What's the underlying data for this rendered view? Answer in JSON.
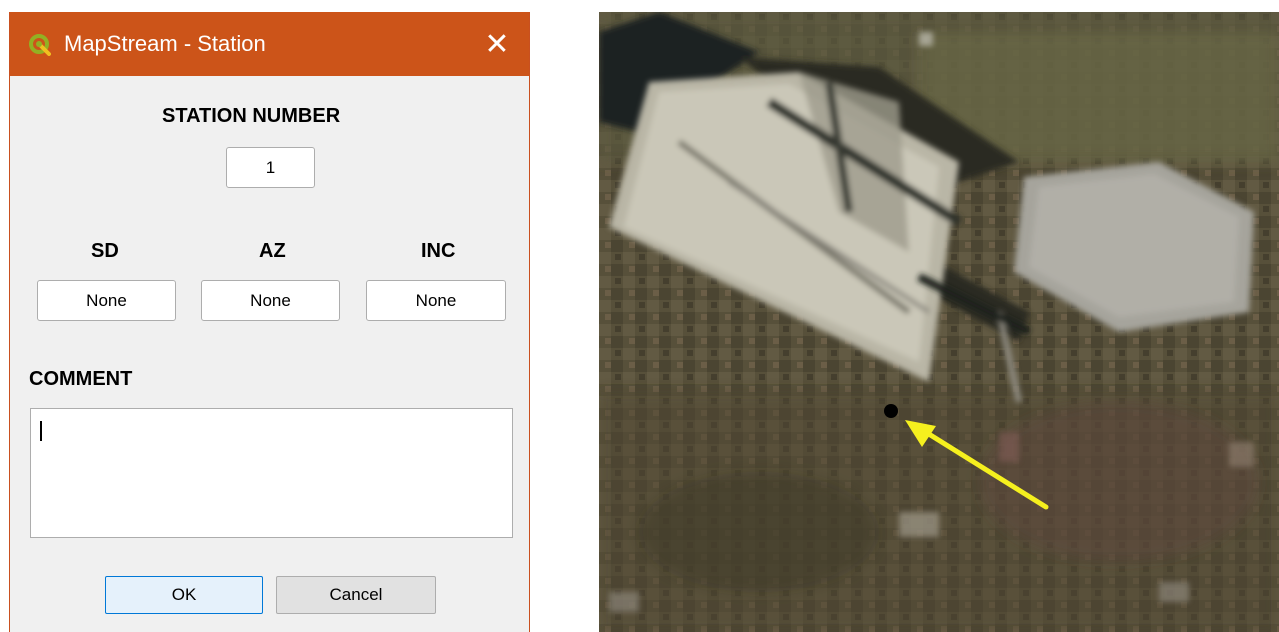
{
  "dialog": {
    "title": "MapStream - Station",
    "app_icon": "qgis-logo-icon",
    "close_icon": "close-icon",
    "close_glyph": "✕",
    "station_number_label": "STATION NUMBER",
    "station_number_value": "1",
    "sd_label": "SD",
    "az_label": "AZ",
    "inc_label": "INC",
    "sd_value": "None",
    "az_value": "None",
    "inc_value": "None",
    "comment_label": "COMMENT",
    "comment_value": "",
    "ok_label": "OK",
    "cancel_label": "Cancel"
  },
  "colors": {
    "titlebar": "#cc5419",
    "dialog_bg": "#f0f0f0",
    "arrow": "#f5f01e",
    "marker": "#000000"
  },
  "map": {
    "type": "aerial-imagery",
    "marker_icon": "station-point-marker",
    "arrow_icon": "yellow-arrow-icon"
  }
}
